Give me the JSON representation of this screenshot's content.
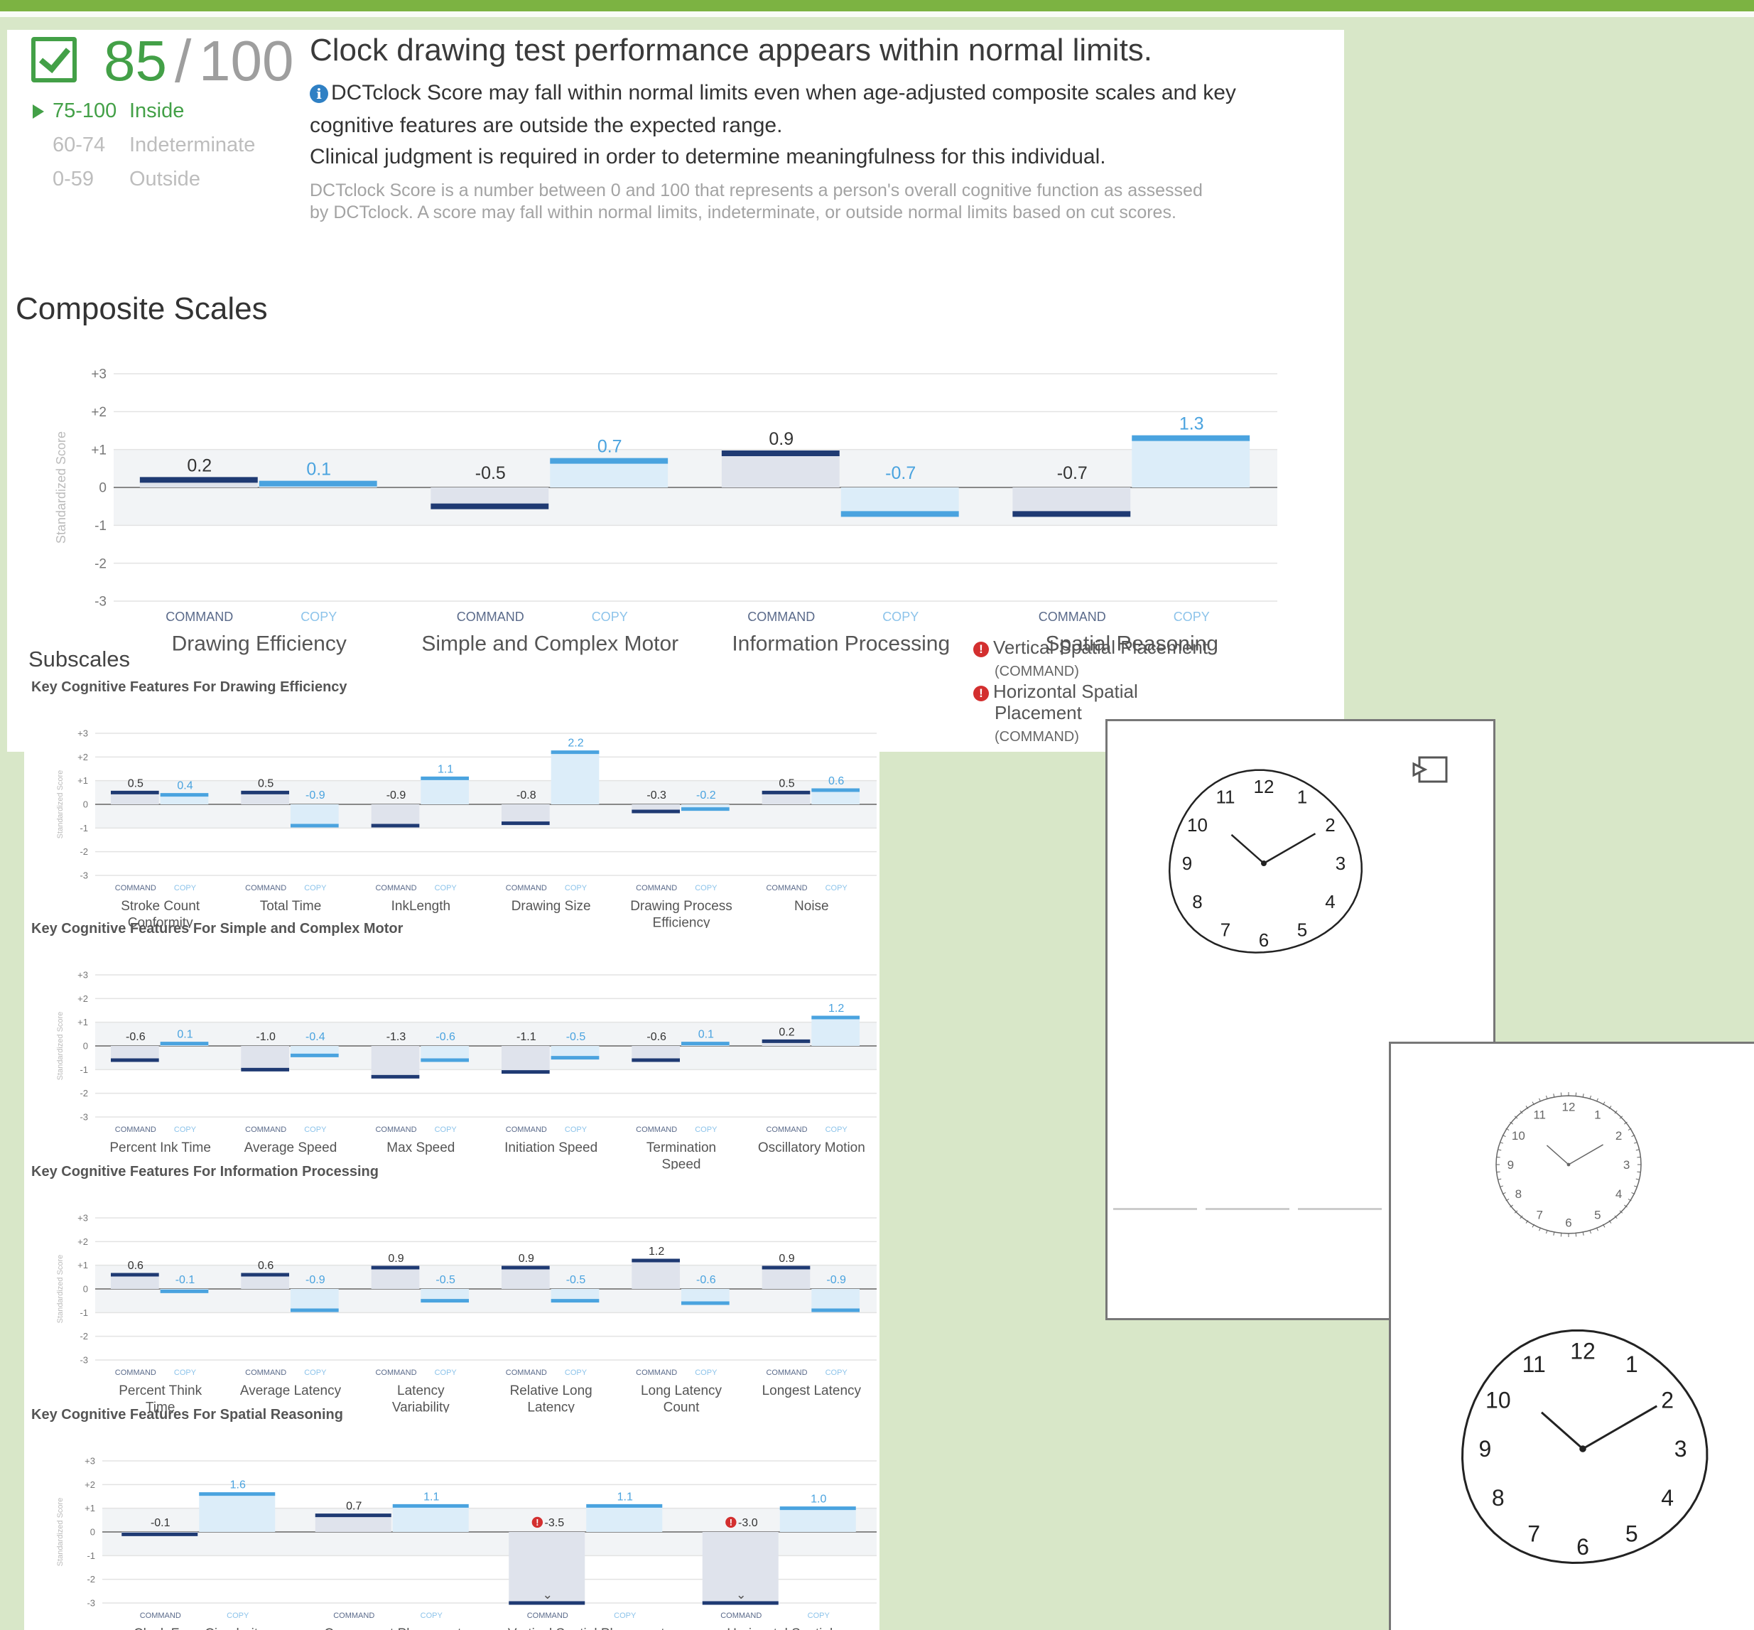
{
  "score": {
    "value": "85",
    "slash": "/",
    "max": "100",
    "ranges": [
      {
        "range": "75-100",
        "label": "Inside",
        "active": true
      },
      {
        "range": "60-74",
        "label": "Indeterminate",
        "active": false
      },
      {
        "range": "0-59",
        "label": "Outside",
        "active": false
      }
    ]
  },
  "headline": "Clock drawing test performance appears within normal limits.",
  "notes": {
    "line1": "DCTclock Score may fall within normal limits even when age-adjusted composite scales and key",
    "line2": "cognitive features are outside the expected range.",
    "line3": "Clinical judgment is required in order to determine meaningfulness for this individual.",
    "fine1": "DCTclock Score is a number between 0 and 100 that represents a person's overall cognitive function as assessed",
    "fine2": "by DCTclock. A score may fall within normal limits, indeterminate, or outside normal limits based on cut scores."
  },
  "composite": {
    "title": "Composite Scales",
    "ylabel": "Standardized Score",
    "cmd_label": "COMMAND",
    "copy_label": "COPY",
    "subscales_title": "Subscales",
    "warnings": [
      {
        "label": "Vertical Spatial Placement",
        "sub": "(COMMAND)"
      },
      {
        "label": "Horizontal Spatial",
        "label2": "Placement",
        "sub": "(COMMAND)"
      }
    ]
  },
  "colors": {
    "command": "#1f3a73",
    "copy": "#4aa3df",
    "accent": "#43a047",
    "warning": "#d32f2f"
  },
  "chart_data": [
    {
      "type": "bar",
      "title": "Composite Scales",
      "ylabel": "Standardized Score",
      "ylim": [
        -3,
        3
      ],
      "yticks": [
        "+3",
        "+2",
        "+1",
        "0",
        "-1",
        "-2",
        "-3"
      ],
      "categories": [
        "Drawing Efficiency",
        "Simple and Complex Motor",
        "Information Processing",
        "Spatial Reasoning"
      ],
      "series": [
        {
          "name": "COMMAND",
          "values": [
            0.2,
            -0.5,
            0.9,
            -0.7
          ],
          "labels": [
            "0.2",
            "-0.5",
            "0.9",
            "-0.7"
          ]
        },
        {
          "name": "COPY",
          "values": [
            0.1,
            0.7,
            -0.7,
            1.3
          ],
          "labels": [
            "0.1",
            "0.7",
            "-0.7",
            "1.3"
          ]
        }
      ]
    },
    {
      "type": "bar",
      "title": "Key Cognitive Features For Drawing Efficiency",
      "ylim": [
        -3,
        3
      ],
      "categories": [
        [
          "Stroke Count",
          "Conformity"
        ],
        [
          "Total Time"
        ],
        [
          "InkLength"
        ],
        [
          "Drawing Size"
        ],
        [
          "Drawing Process",
          "Efficiency"
        ],
        [
          "Noise"
        ]
      ],
      "series": [
        {
          "name": "COMMAND",
          "values": [
            0.5,
            0.5,
            -0.9,
            -0.8,
            -0.3,
            0.5
          ],
          "labels": [
            "0.5",
            "0.5",
            "-0.9",
            "-0.8",
            "-0.3",
            "0.5"
          ]
        },
        {
          "name": "COPY",
          "values": [
            0.4,
            -0.9,
            1.1,
            2.2,
            -0.2,
            0.6
          ],
          "labels": [
            "0.4",
            "-0.9",
            "1.1",
            "2.2",
            "-0.2",
            "0.6"
          ]
        }
      ]
    },
    {
      "type": "bar",
      "title": "Key Cognitive Features For Simple and Complex Motor",
      "ylim": [
        -3,
        3
      ],
      "categories": [
        [
          "Percent Ink Time"
        ],
        [
          "Average Speed"
        ],
        [
          "Max Speed"
        ],
        [
          "Initiation Speed"
        ],
        [
          "Termination",
          "Speed"
        ],
        [
          "Oscillatory Motion"
        ]
      ],
      "series": [
        {
          "name": "COMMAND",
          "values": [
            -0.6,
            -1.0,
            -1.3,
            -1.1,
            -0.6,
            0.2
          ],
          "labels": [
            "-0.6",
            "-1.0",
            "-1.3",
            "-1.1",
            "-0.6",
            "0.2"
          ]
        },
        {
          "name": "COPY",
          "values": [
            0.1,
            -0.4,
            -0.6,
            -0.5,
            0.1,
            1.2
          ],
          "labels": [
            "0.1",
            "-0.4",
            "-0.6",
            "-0.5",
            "0.1",
            "1.2"
          ]
        }
      ]
    },
    {
      "type": "bar",
      "title": "Key Cognitive Features For Information Processing",
      "ylim": [
        -3,
        3
      ],
      "categories": [
        [
          "Percent Think",
          "Time"
        ],
        [
          "Average Latency"
        ],
        [
          "Latency",
          "Variability"
        ],
        [
          "Relative Long",
          "Latency"
        ],
        [
          "Long Latency",
          "Count"
        ],
        [
          "Longest Latency"
        ]
      ],
      "series": [
        {
          "name": "COMMAND",
          "values": [
            0.6,
            0.6,
            0.9,
            0.9,
            1.2,
            0.9
          ],
          "labels": [
            "0.6",
            "0.6",
            "0.9",
            "0.9",
            "1.2",
            "0.9"
          ]
        },
        {
          "name": "COPY",
          "values": [
            -0.1,
            -0.9,
            -0.5,
            -0.5,
            -0.6,
            -0.9
          ],
          "labels": [
            "-0.1",
            "-0.9",
            "-0.5",
            "-0.5",
            "-0.6",
            "-0.9"
          ]
        }
      ]
    },
    {
      "type": "bar",
      "title": "Key Cognitive Features For Spatial Reasoning",
      "ylim": [
        -3,
        3
      ],
      "categories": [
        [
          "Clock Face Circularity"
        ],
        [
          "Component Placement"
        ],
        [
          "Vertical Spatial Placement"
        ],
        [
          "Horizontal Spatial"
        ]
      ],
      "series": [
        {
          "name": "COMMAND",
          "values": [
            -0.1,
            0.7,
            -3.5,
            -3.0
          ],
          "labels": [
            "-0.1",
            "0.7",
            "-3.5",
            "-3.0"
          ],
          "warning": [
            false,
            false,
            true,
            true
          ]
        },
        {
          "name": "COPY",
          "values": [
            1.6,
            1.1,
            1.1,
            1.0
          ],
          "labels": [
            "1.6",
            "1.1",
            "1.1",
            "1.0"
          ]
        }
      ]
    }
  ],
  "clocks": {
    "command_numerals": [
      "12",
      "1",
      "2",
      "3",
      "4",
      "5",
      "6",
      "7",
      "8",
      "9",
      "10",
      "11"
    ],
    "copy_numerals": [
      "12",
      "1",
      "2",
      "3",
      "4",
      "5",
      "6",
      "7",
      "8",
      "9",
      "10",
      "11"
    ]
  }
}
